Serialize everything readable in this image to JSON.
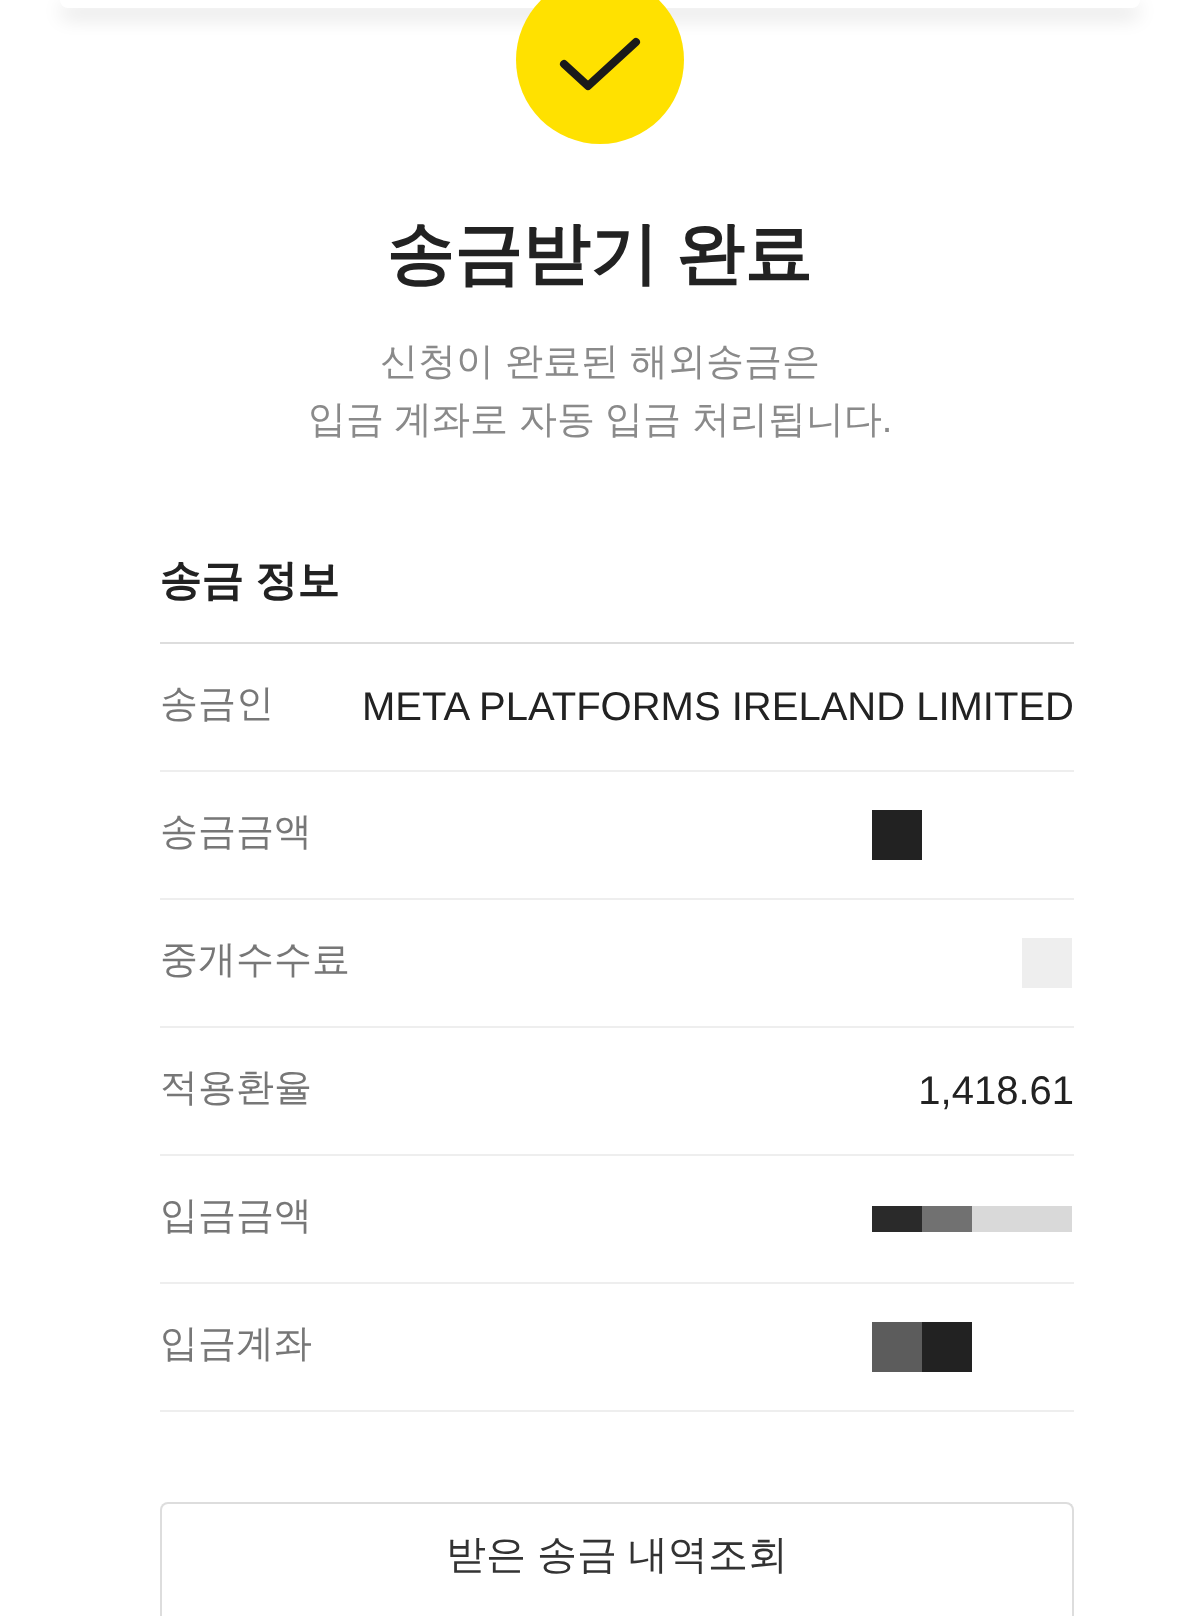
{
  "header": {
    "title": "송금받기 완료",
    "description": "신청이 완료된 해외송금은\n입금 계좌로 자동 입금 처리됩니다."
  },
  "section": {
    "title": "송금 정보",
    "rows": [
      {
        "label": "송금인",
        "value": "META PLATFORMS IRELAND LIMITED"
      },
      {
        "label": "송금금액",
        "masked": [
          {
            "kind": "square",
            "color": "#222222"
          },
          {
            "kind": "blank"
          },
          {
            "kind": "blank"
          },
          {
            "kind": "blank"
          }
        ]
      },
      {
        "label": "중개수수료",
        "masked": [
          {
            "kind": "blank"
          },
          {
            "kind": "blank"
          },
          {
            "kind": "blank"
          },
          {
            "kind": "square",
            "color": "#eeeeee"
          }
        ]
      },
      {
        "label": "적용환율",
        "value": "1,418.61"
      },
      {
        "label": "입금금액",
        "masked": [
          {
            "kind": "strip",
            "color": "#2a2a2a"
          },
          {
            "kind": "strip",
            "color": "#717171"
          },
          {
            "kind": "strip",
            "color": "#d9d9d9"
          },
          {
            "kind": "strip",
            "color": "#d9d9d9"
          }
        ]
      },
      {
        "label": "입금계좌",
        "masked": [
          {
            "kind": "square",
            "color": "#5c5c5c"
          },
          {
            "kind": "square",
            "color": "#222222"
          },
          {
            "kind": "blank"
          },
          {
            "kind": "blank"
          }
        ]
      }
    ]
  },
  "button": {
    "label": "받은 송금 내역조회"
  }
}
